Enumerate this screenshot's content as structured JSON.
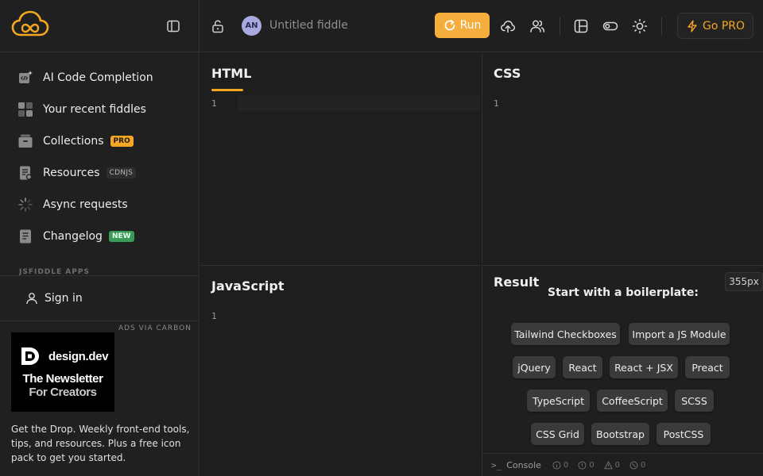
{
  "sidebar": {
    "items": [
      {
        "label": "AI Code Completion",
        "icon": "ai-code-icon"
      },
      {
        "label": "Your recent fiddles",
        "icon": "grid-icon"
      },
      {
        "label": "Collections",
        "icon": "box-icon",
        "badge": "PRO"
      },
      {
        "label": "Resources",
        "icon": "document-icon",
        "badge": "CDNJS"
      },
      {
        "label": "Async requests",
        "icon": "loader-icon"
      },
      {
        "label": "Changelog",
        "icon": "list-doc-icon",
        "badge": "NEW"
      }
    ],
    "apps_label": "JSFIDDLE APPS",
    "signin_label": "Sign in",
    "ads_label": "ADS VIA CARBON",
    "ad": {
      "brand": "design.dev",
      "line1": "The Newsletter",
      "line2": "For Creators",
      "text": "Get the Drop. Weekly front-end tools, tips, and resources. Plus a free icon pack to get you started."
    }
  },
  "topbar": {
    "avatar": "AN",
    "title": "Untitled fiddle",
    "run_label": "Run",
    "gopro_label": "Go PRO"
  },
  "editors": {
    "html": {
      "title": "HTML",
      "line": "1"
    },
    "css": {
      "title": "CSS",
      "line": "1"
    },
    "js": {
      "title": "JavaScript",
      "line": "1"
    }
  },
  "result": {
    "title": "Result",
    "width_label": "355px",
    "boilerplate_title": "Start with a boilerplate:",
    "chips": [
      "Tailwind Checkboxes",
      "Import a JS Module",
      "jQuery",
      "React",
      "React + JSX",
      "Preact",
      "TypeScript",
      "CoffeeScript",
      "SCSS",
      "CSS Grid",
      "Bootstrap",
      "PostCSS"
    ]
  },
  "console": {
    "label": "Console",
    "counts": [
      "0",
      "0",
      "0",
      "0"
    ]
  },
  "colors": {
    "accent": "#f5a623",
    "run": "#f5ad3d",
    "new_badge": "#3a9b57"
  }
}
